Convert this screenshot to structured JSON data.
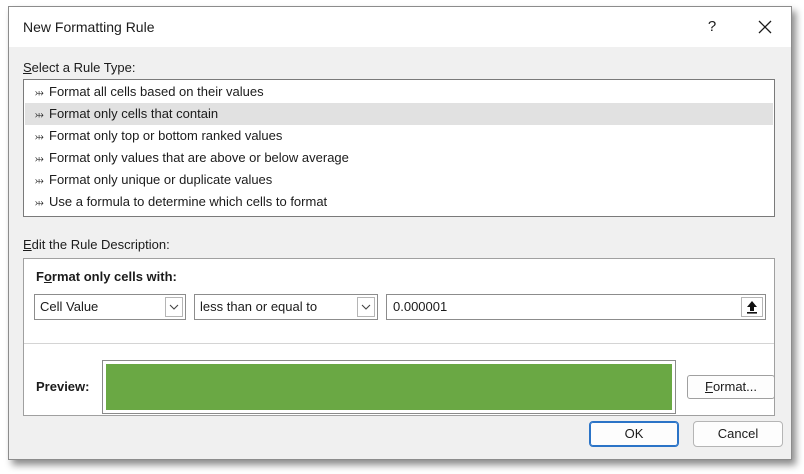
{
  "dialog": {
    "title": "New Formatting Rule",
    "help_glyph": "?",
    "close_label": "Close"
  },
  "rule_type": {
    "label_prefix": "",
    "label_accel": "S",
    "label_rest": "elect a Rule Type:",
    "selected_index": 1,
    "items": [
      {
        "label": "Format all cells based on their values"
      },
      {
        "label": "Format only cells that contain"
      },
      {
        "label": "Format only top or bottom ranked values"
      },
      {
        "label": "Format only values that are above or below average"
      },
      {
        "label": "Format only unique or duplicate values"
      },
      {
        "label": "Use a formula to determine which cells to format"
      }
    ],
    "bullet_glyph": "⤔"
  },
  "description": {
    "label_accel": "E",
    "label_rest": "dit the Rule Description:",
    "heading_prefix": "F",
    "heading_accel": "o",
    "heading_rest": "rmat only cells with:",
    "condition_type": "Cell Value",
    "operator": "less than or equal to",
    "value": "0.000001"
  },
  "preview": {
    "label": "Preview:",
    "fill_color": "#6aa844"
  },
  "buttons": {
    "format_accel": "F",
    "format_rest": "ormat...",
    "ok": "OK",
    "cancel": "Cancel"
  },
  "colors": {
    "accent": "#2b74c7",
    "selection": "#e1e1e1"
  }
}
